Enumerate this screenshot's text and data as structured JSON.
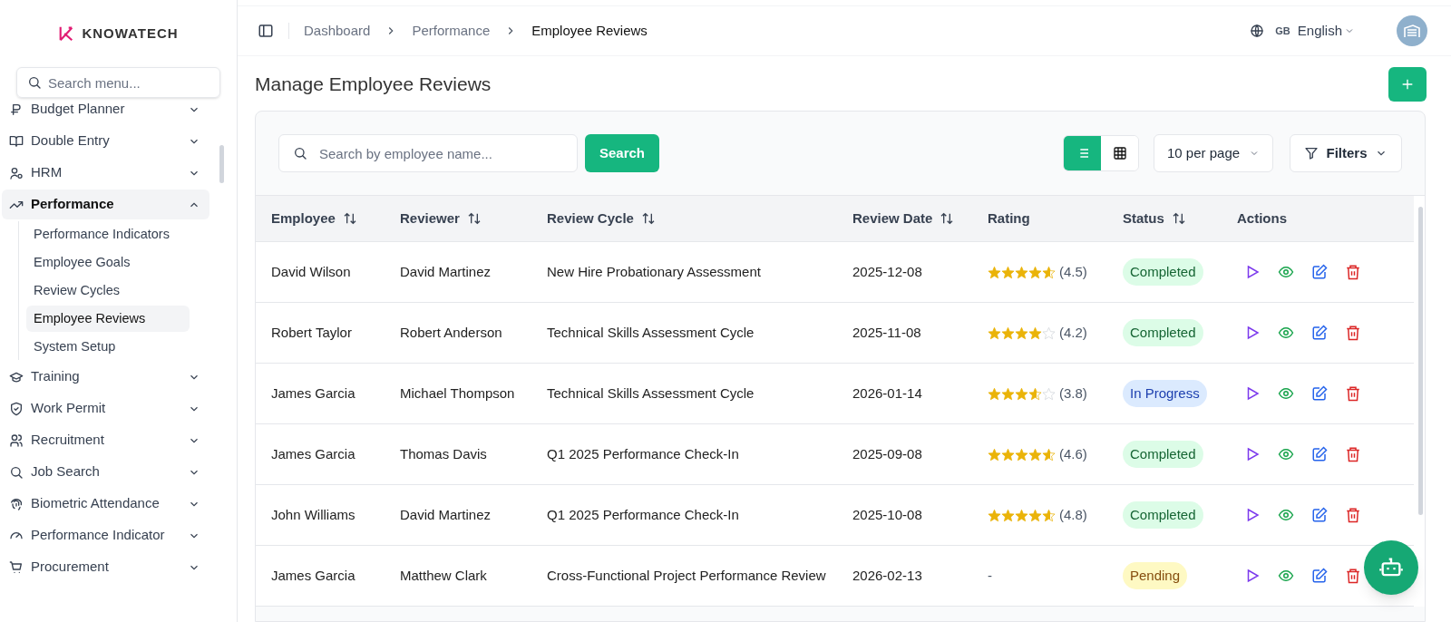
{
  "brand": {
    "name": "KNOWATECH"
  },
  "sidebar": {
    "search": {
      "placeholder": "Search menu..."
    },
    "items": [
      {
        "label": "Budget Planner",
        "expanded": false,
        "selected": false
      },
      {
        "label": "Double Entry",
        "expanded": false,
        "selected": false
      },
      {
        "label": "HRM",
        "expanded": false,
        "selected": false
      },
      {
        "label": "Performance",
        "expanded": true,
        "selected": true,
        "children": [
          {
            "label": "Performance Indicators",
            "selected": false
          },
          {
            "label": "Employee Goals",
            "selected": false
          },
          {
            "label": "Review Cycles",
            "selected": false
          },
          {
            "label": "Employee Reviews",
            "selected": true
          },
          {
            "label": "System Setup",
            "selected": false
          }
        ]
      },
      {
        "label": "Training",
        "expanded": false,
        "selected": false
      },
      {
        "label": "Work Permit",
        "expanded": false,
        "selected": false
      },
      {
        "label": "Recruitment",
        "expanded": false,
        "selected": false
      },
      {
        "label": "Job Search",
        "expanded": false,
        "selected": false
      },
      {
        "label": "Biometric Attendance",
        "expanded": false,
        "selected": false
      },
      {
        "label": "Performance Indicator",
        "expanded": false,
        "selected": false
      },
      {
        "label": "Procurement",
        "expanded": false,
        "selected": false
      }
    ]
  },
  "breadcrumbs": [
    {
      "label": "Dashboard",
      "current": false
    },
    {
      "label": "Performance",
      "current": false
    },
    {
      "label": "Employee Reviews",
      "current": true
    }
  ],
  "language": {
    "code": "GB",
    "label": "English"
  },
  "page_title": "Manage Employee Reviews",
  "toolbar": {
    "search": {
      "placeholder": "Search by employee name..."
    },
    "search_button": "Search",
    "views": [
      {
        "kind": "list",
        "selected": true
      },
      {
        "kind": "grid",
        "selected": false
      }
    ],
    "per_page": "10 per page",
    "filters": "Filters"
  },
  "table": {
    "columns": [
      {
        "label": "Employee",
        "sortable": true
      },
      {
        "label": "Reviewer",
        "sortable": true
      },
      {
        "label": "Review Cycle",
        "sortable": true
      },
      {
        "label": "Review Date",
        "sortable": true
      },
      {
        "label": "Rating",
        "sortable": false
      },
      {
        "label": "Status",
        "sortable": true
      },
      {
        "label": "Actions",
        "sortable": false
      }
    ],
    "rows": [
      {
        "employee": "David Wilson",
        "reviewer": "David Martinez",
        "cycle": "New Hire Probationary Assessment",
        "date": "2025-12-08",
        "stars": 4.5,
        "rating": "(4.5)",
        "status": {
          "label": "Completed",
          "kind": "completed"
        }
      },
      {
        "employee": "Robert Taylor",
        "reviewer": "Robert Anderson",
        "cycle": "Technical Skills Assessment Cycle",
        "date": "2025-11-08",
        "stars": 4,
        "rating": "(4.2)",
        "status": {
          "label": "Completed",
          "kind": "completed"
        }
      },
      {
        "employee": "James Garcia",
        "reviewer": "Michael Thompson",
        "cycle": "Technical Skills Assessment Cycle",
        "date": "2026-01-14",
        "stars": 3.5,
        "rating": "(3.8)",
        "status": {
          "label": "In Progress",
          "kind": "progress"
        }
      },
      {
        "employee": "James Garcia",
        "reviewer": "Thomas Davis",
        "cycle": "Q1 2025 Performance Check-In",
        "date": "2025-09-08",
        "stars": 4.5,
        "rating": "(4.6)",
        "status": {
          "label": "Completed",
          "kind": "completed"
        }
      },
      {
        "employee": "John Williams",
        "reviewer": "David Martinez",
        "cycle": "Q1 2025 Performance Check-In",
        "date": "2025-10-08",
        "stars": 4.5,
        "rating": "(4.8)",
        "status": {
          "label": "Completed",
          "kind": "completed"
        }
      },
      {
        "employee": "James Garcia",
        "reviewer": "Matthew Clark",
        "cycle": "Cross-Functional Project Performance Review",
        "date": "2026-02-13",
        "rating": "-",
        "status": {
          "label": "Pending",
          "kind": "pending"
        }
      }
    ]
  }
}
